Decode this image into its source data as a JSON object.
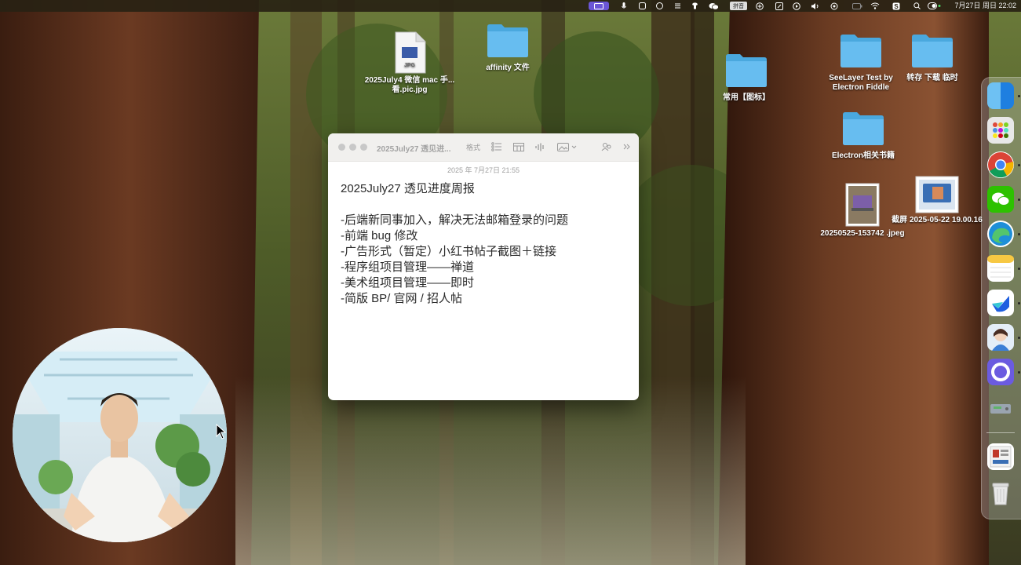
{
  "menubar": {
    "clock": "7月27日 周日  22:02",
    "icons": [
      "screen-share-icon",
      "microphone-icon",
      "app-icon",
      "app-icon",
      "lines-icon",
      "wechat-icon",
      "keyboard-icon",
      "grid-icon",
      "edit-icon",
      "play-icon",
      "volume-icon",
      "airdrop-icon",
      "wifi-icon",
      "battery-icon",
      "app-s-icon",
      "search-icon",
      "control-center-icon"
    ],
    "keyboard_label": "拼音"
  },
  "desktop": {
    "items": [
      {
        "label": "2025July4 微信 mac 手...看.pic.jpg",
        "badge": "JPG"
      },
      {
        "label": "affinity 文件"
      },
      {
        "label": "常用【图标】"
      },
      {
        "label": "SeeLayer Test by Electron Fiddle"
      },
      {
        "label": "转存 下载 临时"
      },
      {
        "label": "Electron相关书籍"
      },
      {
        "label": "20250525-153742 .jpeg"
      },
      {
        "label": "截屏 2025-05-22 19.00.16"
      }
    ]
  },
  "note": {
    "title": "2025July27 透见进...",
    "toolbar_format": "格式",
    "date": "2025 年 7月27日 21:55",
    "heading": "2025July27 透见进度周报",
    "lines": [
      "-后端新同事加入，解决无法邮箱登录的问题",
      "-前端 bug 修改",
      "-广告形式（暂定）小红书帖子截图＋链接",
      "-程序组项目管理——禅道",
      "-美术组项目管理——即时",
      "-简版 BP/ 官网 / 招人帖"
    ]
  },
  "dock": {
    "apps": [
      "finder",
      "launchpad",
      "chrome",
      "wechat",
      "edge",
      "notes",
      "feishu",
      "avatar-app",
      "arc",
      "disk-utility",
      "preview",
      "trash"
    ]
  },
  "colors": {
    "folder": "#5bb7e8",
    "menubar": "#2a2214",
    "accent": "#6b56d6"
  }
}
